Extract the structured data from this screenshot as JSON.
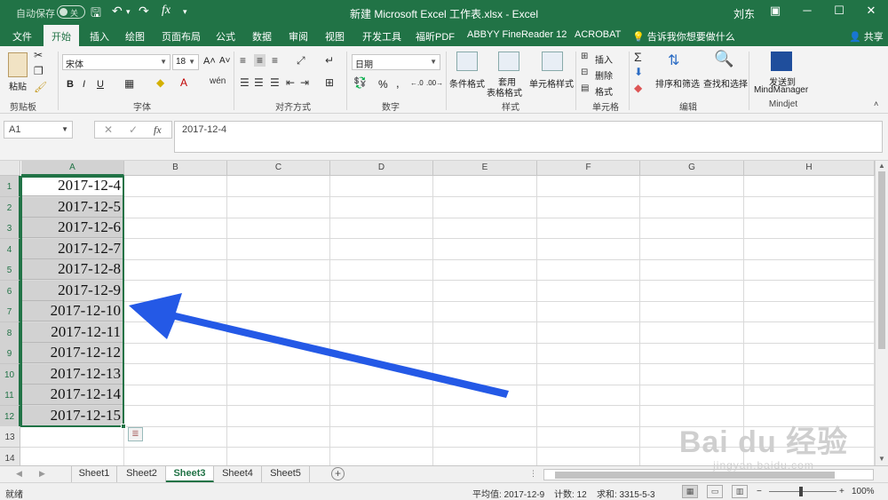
{
  "titlebar": {
    "autosave_label": "自动保存",
    "autosave_state": "关",
    "title": "新建 Microsoft Excel 工作表.xlsx - Excel",
    "user": "刘东"
  },
  "tabs": [
    {
      "label": "文件",
      "active": false
    },
    {
      "label": "开始",
      "active": true
    },
    {
      "label": "插入",
      "active": false
    },
    {
      "label": "绘图",
      "active": false
    },
    {
      "label": "页面布局",
      "active": false
    },
    {
      "label": "公式",
      "active": false
    },
    {
      "label": "数据",
      "active": false
    },
    {
      "label": "审阅",
      "active": false
    },
    {
      "label": "视图",
      "active": false
    },
    {
      "label": "开发工具",
      "active": false
    },
    {
      "label": "福昕PDF",
      "active": false
    },
    {
      "label": "ABBYY FineReader 12",
      "active": false
    },
    {
      "label": "ACROBAT",
      "active": false
    }
  ],
  "tell_me": "告诉我你想要做什么",
  "share": "共享",
  "ribbon": {
    "paste": "粘贴",
    "clipboard": "剪贴板",
    "font_name": "宋体",
    "font_size": "18",
    "font_group": "字体",
    "bold": "B",
    "italic": "I",
    "underline": "U",
    "align_group": "对齐方式",
    "number_format": "日期",
    "number_group": "数字",
    "percent": "%",
    "comma": ",",
    "cond_format": "条件格式",
    "table_format_1": "套用",
    "table_format_2": "表格格式",
    "cell_style": "单元格样式",
    "style_group": "样式",
    "insert": "插入",
    "delete": "删除",
    "format": "格式",
    "cells_group": "单元格",
    "sort_filter": "排序和筛选",
    "find_select": "查找和选择",
    "edit_group": "编辑",
    "send_to_1": "发送到",
    "send_to_2": "MindManager",
    "mindjet_group": "Mindjet"
  },
  "formula_bar": {
    "name_box": "A1",
    "cancel": "✕",
    "enter": "✓",
    "fx": "fx",
    "value": "2017-12-4"
  },
  "columns": [
    "A",
    "B",
    "C",
    "D",
    "E",
    "F",
    "G",
    "H"
  ],
  "rows": [
    "1",
    "2",
    "3",
    "4",
    "5",
    "6",
    "7",
    "8",
    "9",
    "10",
    "11",
    "12",
    "13",
    "14"
  ],
  "cells_a": [
    "2017-12-4",
    "2017-12-5",
    "2017-12-6",
    "2017-12-7",
    "2017-12-8",
    "2017-12-9",
    "2017-12-10",
    "2017-12-11",
    "2017-12-12",
    "2017-12-13",
    "2017-12-14",
    "2017-12-15"
  ],
  "sheets": [
    {
      "label": "Sheet1",
      "active": false
    },
    {
      "label": "Sheet2",
      "active": false
    },
    {
      "label": "Sheet3",
      "active": true
    },
    {
      "label": "Sheet4",
      "active": false
    },
    {
      "label": "Sheet5",
      "active": false
    }
  ],
  "status": {
    "mode": "就绪",
    "average": "平均值: 2017-12-9",
    "count": "计数: 12",
    "sum": "求和: 3315-5-3",
    "zoom": "100%"
  },
  "watermark": {
    "main": "Bai du 经验",
    "sub": "jingyan.baidu.com"
  },
  "colors": {
    "accent": "#217346",
    "arrow": "#2459e6"
  }
}
